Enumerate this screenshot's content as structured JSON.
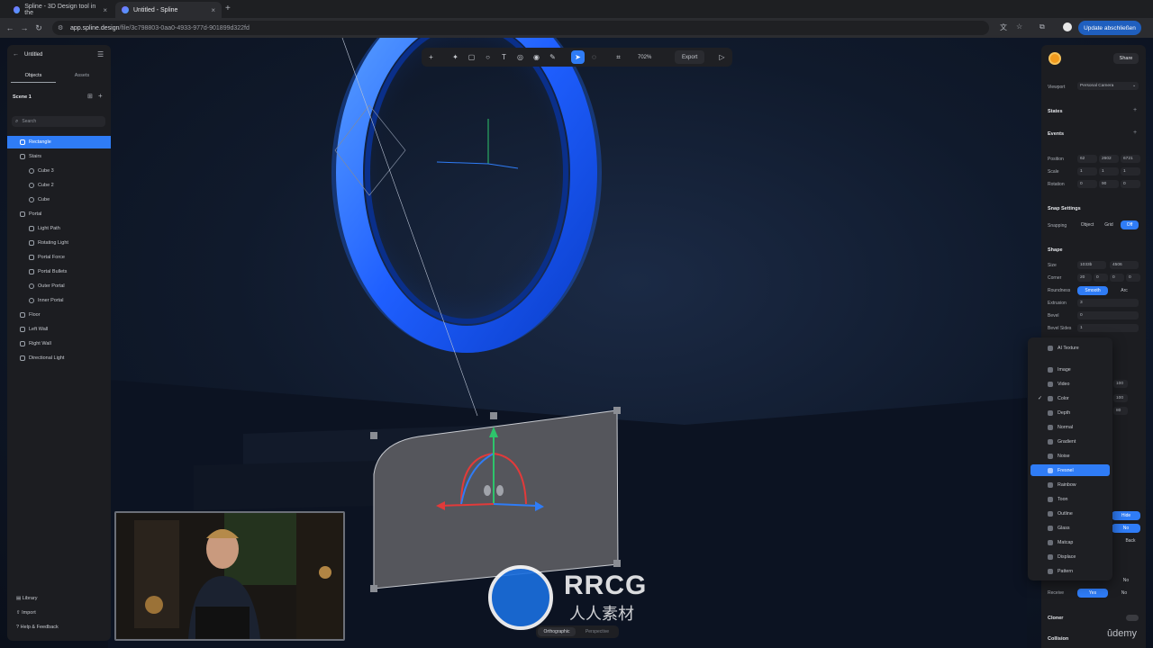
{
  "browser": {
    "tabs": [
      {
        "label": "Spline - 3D Design tool in the",
        "active": false
      },
      {
        "label": "Untitled - Spline",
        "active": true
      }
    ],
    "url_host": "app.spline.design",
    "url_path": "/file/3c798803-0aa0-4933-977d-901899d322fd",
    "update_button": "Update abschließen"
  },
  "left_panel": {
    "file_title": "Untitled",
    "tabs": [
      "Objects",
      "Assets"
    ],
    "scene_label": "Scene 1",
    "search_placeholder": "Search",
    "objects": [
      {
        "label": "Rectangle",
        "icon": "rectangle-icon",
        "level": 0,
        "selected": true
      },
      {
        "label": "Stairs",
        "icon": "group-icon",
        "level": 0
      },
      {
        "label": "Cube 3",
        "icon": "cube-icon",
        "level": 1
      },
      {
        "label": "Cube 2",
        "icon": "cube-icon",
        "level": 1
      },
      {
        "label": "Cube",
        "icon": "cube-icon",
        "level": 1
      },
      {
        "label": "Portal",
        "icon": "group-icon",
        "level": 0
      },
      {
        "label": "Light Path",
        "icon": "path-icon",
        "level": 1
      },
      {
        "label": "Rotating Light",
        "icon": "light-icon",
        "level": 1
      },
      {
        "label": "Portal Force",
        "icon": "force-icon",
        "level": 1
      },
      {
        "label": "Portal Bullets",
        "icon": "particles-icon",
        "level": 1
      },
      {
        "label": "Outer Portal",
        "icon": "torus-icon",
        "level": 1
      },
      {
        "label": "Inner Portal",
        "icon": "torus-icon",
        "level": 1
      },
      {
        "label": "Floor",
        "icon": "rectangle-icon",
        "level": 0
      },
      {
        "label": "Left Wall",
        "icon": "rectangle-icon",
        "level": 0
      },
      {
        "label": "Right Wall",
        "icon": "rectangle-icon",
        "level": 0
      },
      {
        "label": "Directional Light",
        "icon": "light-icon",
        "level": 0
      }
    ],
    "footer": [
      "Library",
      "Import",
      "Help & Feedback"
    ]
  },
  "toolbar": {
    "zoom": "702%",
    "export_label": "Export"
  },
  "right_panel": {
    "share_label": "Share",
    "viewport_label": "Viewport",
    "viewport_value": "Personal Camera",
    "states_label": "States",
    "events_label": "Events",
    "position_label": "Position",
    "position_values": [
      "62",
      "2602",
      "6721"
    ],
    "scale_label": "Scale",
    "scale_values": [
      "1",
      "1",
      "1"
    ],
    "rotation_label": "Rotation",
    "rotation_values": [
      "0",
      "90",
      "0"
    ],
    "snap_title": "Snap Settings",
    "snapping_label": "Snapping",
    "snapping_options": [
      "Object",
      "Grid",
      "Off"
    ],
    "shape_title": "Shape",
    "size_label": "Size",
    "size_values": [
      "1033b",
      "4506"
    ],
    "corner_label": "Corner",
    "corner_values": [
      "20",
      "0",
      "0",
      "0"
    ],
    "roundness_label": "Roundness",
    "roundness_options": [
      "Smooth",
      "Arc"
    ],
    "extrusion_label": "Extrusion",
    "extrusion_value": "3",
    "bevel_label": "Bevel",
    "bevel_value": "0",
    "bevel_sides_label": "Bevel Sides",
    "bevel_sides_value": "1",
    "hidden_values": [
      "100",
      "100",
      "80"
    ],
    "hide_label": "Hide",
    "no_label": "No",
    "back_label": "Back",
    "receive_label": "Receive",
    "receive_value": "Yes",
    "receive_no": "No",
    "cloner_label": "Cloner",
    "collision_label": "Collision"
  },
  "material_dropdown": {
    "items": [
      {
        "label": "AI Texture",
        "icon": "ai-texture-icon"
      },
      {
        "label": "Image",
        "icon": "image-icon"
      },
      {
        "label": "Video",
        "icon": "video-icon"
      },
      {
        "label": "Color",
        "icon": "color-icon",
        "checked": true
      },
      {
        "label": "Depth",
        "icon": "depth-icon"
      },
      {
        "label": "Normal",
        "icon": "normal-icon"
      },
      {
        "label": "Gradient",
        "icon": "gradient-icon"
      },
      {
        "label": "Noise",
        "icon": "noise-icon"
      },
      {
        "label": "Fresnel",
        "icon": "fresnel-icon",
        "selected": true
      },
      {
        "label": "Rainbow",
        "icon": "rainbow-icon"
      },
      {
        "label": "Toon",
        "icon": "toon-icon"
      },
      {
        "label": "Outline",
        "icon": "outline-icon"
      },
      {
        "label": "Glass",
        "icon": "glass-icon"
      },
      {
        "label": "Matcap",
        "icon": "matcap-icon"
      },
      {
        "label": "Displace",
        "icon": "displace-icon"
      },
      {
        "label": "Pattern",
        "icon": "pattern-icon"
      }
    ]
  },
  "view_toggle": [
    "Orthographic",
    "Perspective"
  ],
  "watermark": {
    "title": "RRCG",
    "subtitle": "人人素材"
  },
  "udemy_logo": "ûdemy",
  "colors": {
    "accent": "#2f7cf6",
    "portal": "#1f6bff",
    "panel": "#1c1d21"
  }
}
